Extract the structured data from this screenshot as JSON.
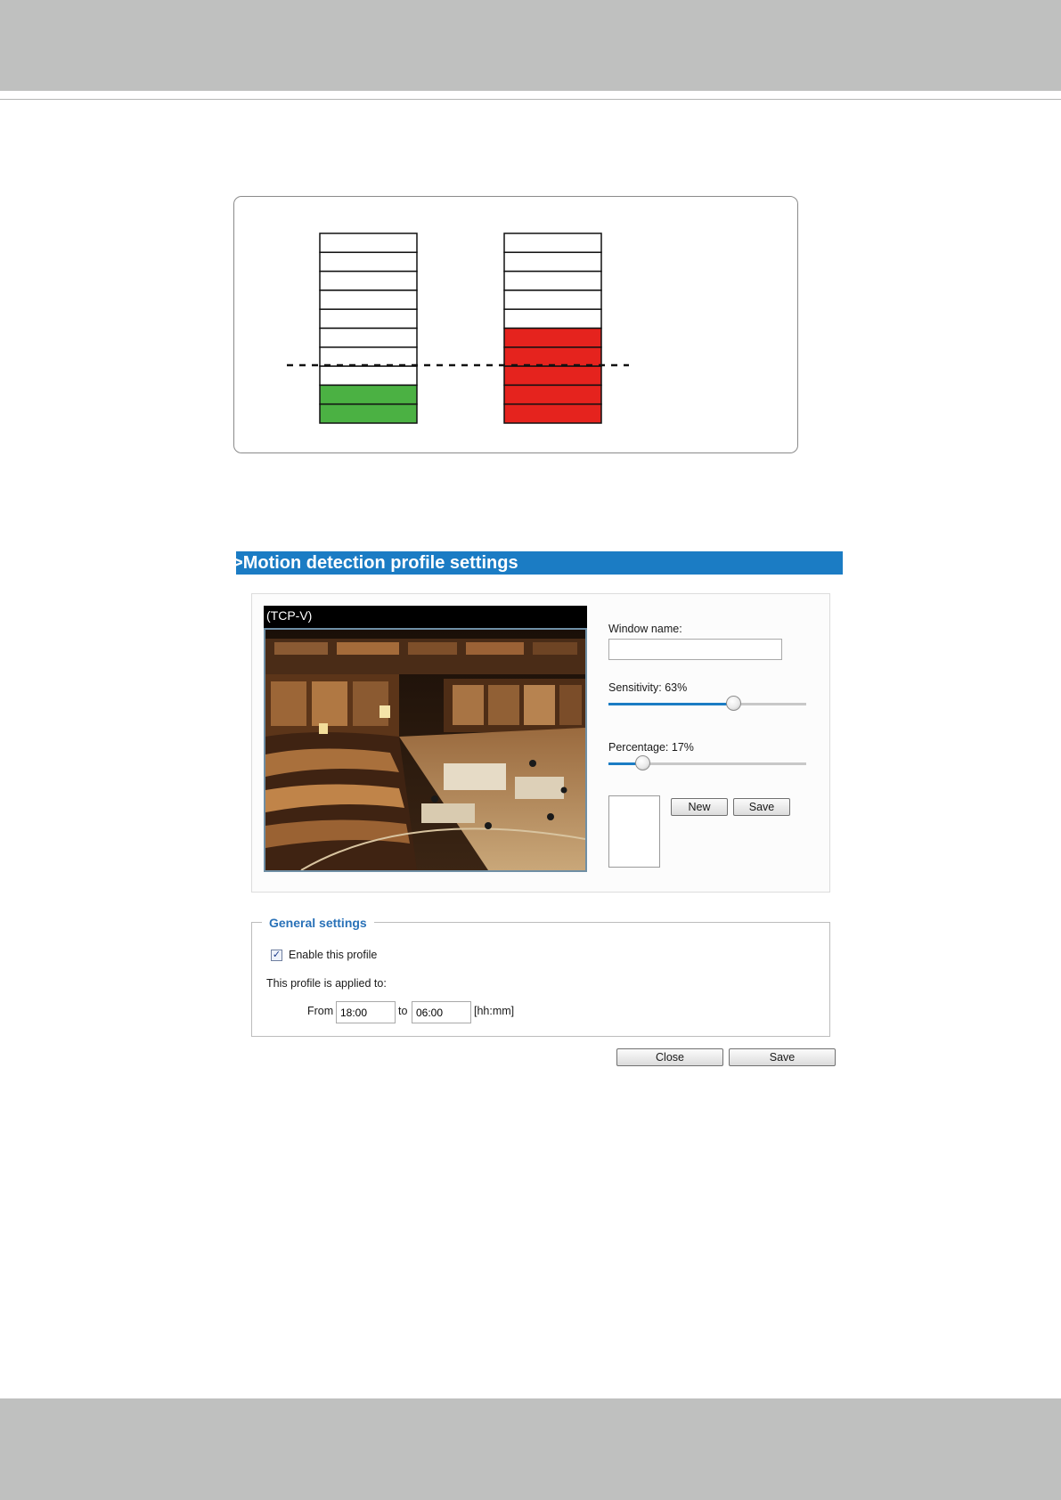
{
  "diagram": {
    "left_column_levels": 10,
    "left_column_filled": 2,
    "left_fill_color": "#4bb143",
    "right_column_levels": 10,
    "right_column_filled": 5,
    "right_fill_color": "#e5231e",
    "threshold_level": 3
  },
  "profile": {
    "header_arrow": ">",
    "header_title": "Motion detection profile settings",
    "video_title": "(TCP-V)",
    "window_name_label": "Window name:",
    "window_name_value": "",
    "sensitivity_label": "Sensitivity: 63%",
    "sensitivity_value": 63,
    "percentage_label": "Percentage: 17%",
    "percentage_value": 17,
    "new_button": "New",
    "save_window_button": "Save",
    "accent_color": "#1b7cc4"
  },
  "general": {
    "legend": "General settings",
    "enable_label": "Enable this profile",
    "enable_checked": true,
    "applied_label": "This profile is applied to:",
    "from_label": "From",
    "from_value": "18:00",
    "to_label": "to",
    "to_value": "06:00",
    "format_hint": "[hh:mm]"
  },
  "footer_buttons": {
    "close": "Close",
    "save": "Save"
  }
}
